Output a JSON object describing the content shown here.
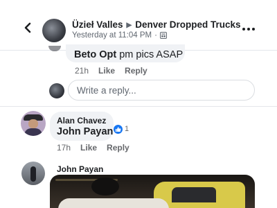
{
  "header": {
    "author": "Üzieł Valles",
    "group": "Denver Dropped Trucks",
    "timestamp": "Yesterday at 11:04 PM",
    "separator": "·",
    "privacy_icon": "group-audience-icon",
    "back_icon": "chevron-left-icon",
    "more_icon": "more-horizontal-icon"
  },
  "comments": [
    {
      "mention": "Beto Opt",
      "text": " pm pics ASAP",
      "age": "21h",
      "like_label": "Like",
      "reply_label": "Reply"
    },
    {
      "author": "Alan Chavez",
      "mention": "John Payan",
      "reaction_icon": "like-icon",
      "reaction_count": "1",
      "age": "17h",
      "like_label": "Like",
      "reply_label": "Reply"
    },
    {
      "author": "John Payan",
      "attachment": "photo"
    }
  ],
  "reply_box": {
    "placeholder": "Write a reply..."
  },
  "colors": {
    "accent": "#1877f2",
    "bubble": "#f0f2f5",
    "meta_text": "#65676b"
  }
}
